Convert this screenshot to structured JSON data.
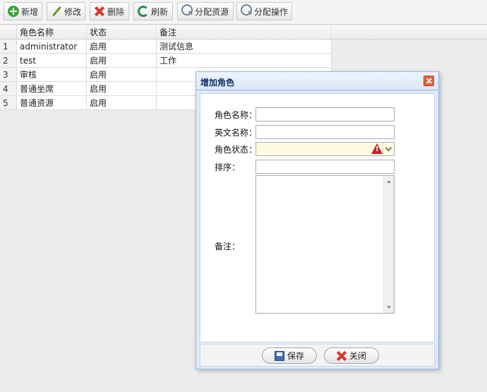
{
  "toolbar": {
    "buttons": [
      {
        "label": "新增",
        "icon": "add-icon"
      },
      {
        "label": "修改",
        "icon": "edit-icon"
      },
      {
        "label": "删除",
        "icon": "delete-icon"
      },
      {
        "label": "刷新",
        "icon": "refresh-icon"
      },
      {
        "label": "分配资源",
        "icon": "search-icon"
      },
      {
        "label": "分配操作",
        "icon": "search-icon"
      }
    ]
  },
  "grid": {
    "columns": [
      "角色名称",
      "状态",
      "备注"
    ],
    "rows": [
      {
        "num": "1",
        "name": "administrator",
        "status": "启用",
        "note": "测试信息"
      },
      {
        "num": "2",
        "name": "test",
        "status": "启用",
        "note": "工作"
      },
      {
        "num": "3",
        "name": "审核",
        "status": "启用",
        "note": ""
      },
      {
        "num": "4",
        "name": "普通坐席",
        "status": "启用",
        "note": ""
      },
      {
        "num": "5",
        "name": "普通资源",
        "status": "启用",
        "note": ""
      }
    ]
  },
  "dialog": {
    "title": "增加角色",
    "fields": {
      "role_name_label": "角色名称：",
      "role_name_value": "",
      "english_name_label": "英文名称：",
      "english_name_value": "",
      "role_status_label": "角色状态：",
      "role_status_value": "",
      "sort_label": "排序：",
      "sort_value": "",
      "remark_label": "备注：",
      "remark_value": ""
    },
    "save_label": "保存",
    "close_label": "关闭"
  },
  "colors": {
    "dialog_border": "#95b8e7",
    "dialog_title_text": "#0e2d5f",
    "warning": "#c0262b",
    "select_invalid_bg": "#fffbe0"
  }
}
